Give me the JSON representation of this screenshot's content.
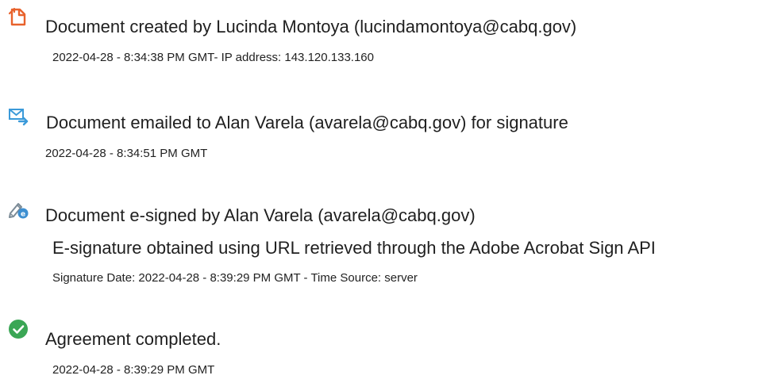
{
  "events": [
    {
      "icon": "document-created-icon",
      "title": "Document created by Lucinda Montoya (lucindamontoya@cabq.gov)",
      "meta": "2022-04-28 - 8:34:38 PM GMT- IP address: 143.120.133.160"
    },
    {
      "icon": "email-send-icon",
      "title": "Document emailed to Alan Varela (avarela@cabq.gov) for signature",
      "meta": "2022-04-28 - 8:34:51 PM GMT"
    },
    {
      "icon": "e-sign-pen-icon",
      "title": "Document e-signed by Alan Varela (avarela@cabq.gov)",
      "detail": "E-signature obtained using URL retrieved through the Adobe Acrobat Sign API",
      "meta": "Signature Date: 2022-04-28 - 8:39:29 PM GMT - Time Source: server"
    },
    {
      "icon": "check-circle-icon",
      "title": "Agreement completed.",
      "meta": "2022-04-28 - 8:39:29 PM GMT"
    }
  ],
  "colors": {
    "created_icon": "#e8622c",
    "email_icon": "#3b9ad9",
    "esign_pen": "#7a8a96",
    "esign_badge": "#3d8fd1",
    "check_icon": "#3aa655"
  }
}
